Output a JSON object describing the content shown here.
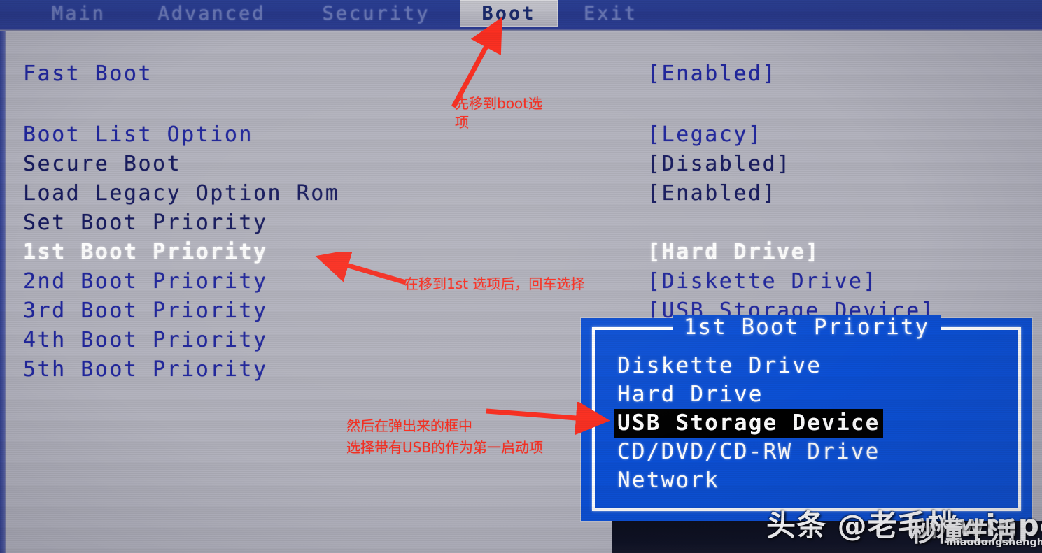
{
  "menubar": {
    "tabs": [
      {
        "label": "Main",
        "active": false
      },
      {
        "label": "Advanced",
        "active": false
      },
      {
        "label": "Security",
        "active": false
      },
      {
        "label": "Boot",
        "active": true
      },
      {
        "label": "Exit",
        "active": false
      }
    ]
  },
  "settings": [
    {
      "label": "Fast Boot",
      "value": "[Enabled]",
      "highlighted": false
    },
    {
      "label": "Boot List Option",
      "value": "[Legacy]",
      "highlighted": false
    },
    {
      "label": "Secure Boot",
      "value": "[Disabled]",
      "highlighted": false
    },
    {
      "label": "Load Legacy Option Rom",
      "value": "[Enabled]",
      "highlighted": false
    },
    {
      "label": "Set Boot Priority",
      "value": "",
      "highlighted": false
    },
    {
      "label": "1st Boot Priority",
      "value": "[Hard Drive]",
      "highlighted": true
    },
    {
      "label": "2nd Boot Priority",
      "value": "[Diskette Drive]",
      "highlighted": false
    },
    {
      "label": "3rd Boot Priority",
      "value": "[USB Storage Device]",
      "highlighted": false
    },
    {
      "label": "4th Boot Priority",
      "value": "",
      "highlighted": false
    },
    {
      "label": "5th Boot Priority",
      "value": "",
      "highlighted": false
    }
  ],
  "popup": {
    "title": "1st Boot Priority",
    "options": [
      {
        "label": "Diskette Drive",
        "selected": false
      },
      {
        "label": "Hard Drive",
        "selected": false
      },
      {
        "label": "USB Storage Device",
        "selected": true
      },
      {
        "label": "CD/DVD/CD-RW Drive",
        "selected": false
      },
      {
        "label": "Network",
        "selected": false
      }
    ]
  },
  "annotations": [
    {
      "id": "annot1",
      "text": "先移到boot选\n项"
    },
    {
      "id": "annot2",
      "text": "在移到1st 选项后，回车选择"
    },
    {
      "id": "annot3",
      "text": "然后在弹出来的框中\n选择带有USB的作为第一启动项"
    }
  ],
  "watermarks": {
    "toutiao": "头条 @老毛桃winpe",
    "miaodong": "秒懂生活",
    "url": "miaodongshenghuo.com"
  },
  "colors": {
    "background": "#b2b2bd",
    "menubar": "#2a3f93",
    "active_tab_bg": "#bcbcc6",
    "text_blue": "#20269c",
    "text_dark_blue": "#161a5e",
    "text_highlight": "#ffffff",
    "popup_bg": "#0b4fd4",
    "popup_selected_bg": "#000000",
    "annotation_red": "#fb2e20"
  }
}
